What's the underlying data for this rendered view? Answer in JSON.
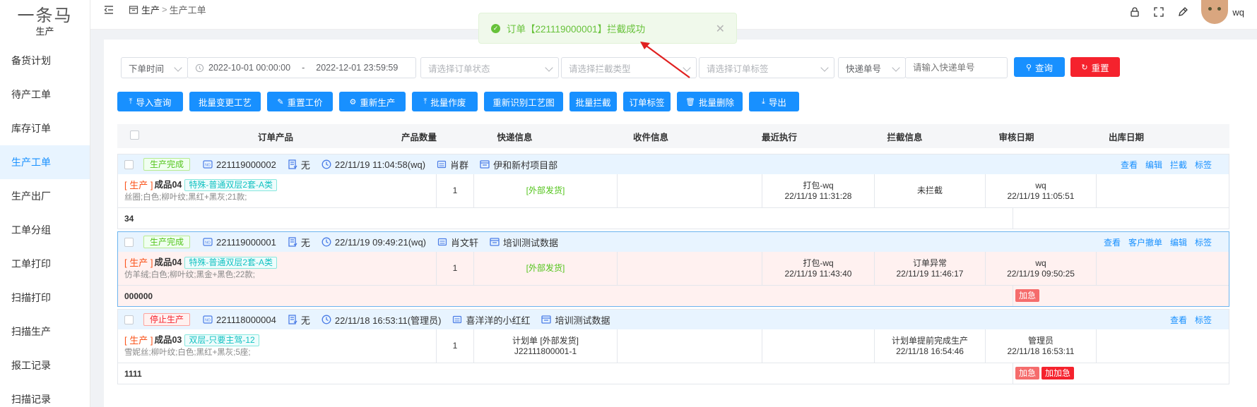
{
  "sidebar": {
    "logo": "一条马",
    "section": "生产",
    "items": [
      {
        "label": "备货计划"
      },
      {
        "label": "待产工单"
      },
      {
        "label": "库存订单"
      },
      {
        "label": "生产工单",
        "active": true
      },
      {
        "label": "生产出厂"
      },
      {
        "label": "工单分组"
      },
      {
        "label": "工单打印"
      },
      {
        "label": "扫描打印"
      },
      {
        "label": "扫描生产"
      },
      {
        "label": "报工记录"
      },
      {
        "label": "扫描记录"
      }
    ]
  },
  "header": {
    "breadcrumb": {
      "root": "生产",
      "separator": ">",
      "current": "生产工单"
    },
    "username": "wq",
    "icons": [
      "collapse-icon",
      "lock-icon",
      "fullscreen-icon",
      "brush-icon"
    ]
  },
  "toast": {
    "message": "订单【221119000001】拦截成功",
    "type": "success"
  },
  "filters": {
    "time_type": "下单时间",
    "date_start": "2022-10-01 00:00:00",
    "date_sep": "-",
    "date_end": "2022-12-01 23:59:59",
    "order_status_placeholder": "请选择订单状态",
    "intercept_type_placeholder": "请选择拦截类型",
    "order_tag_placeholder": "请选择订单标签",
    "express_type": "快递单号",
    "express_placeholder": "请输入快递单号",
    "search_label": "查询",
    "reset_label": "重置"
  },
  "actions": [
    {
      "label": "导入查询",
      "icon": "upload-icon"
    },
    {
      "label": "批量变更工艺",
      "icon": ""
    },
    {
      "label": "重置工价",
      "icon": "edit-icon"
    },
    {
      "label": "重新生产",
      "icon": "gear-icon"
    },
    {
      "label": "批量作废",
      "icon": "upload-icon"
    },
    {
      "label": "重新识别工艺图",
      "icon": ""
    },
    {
      "label": "批量拦截",
      "icon": ""
    },
    {
      "label": "订单标签",
      "icon": ""
    },
    {
      "label": "批量删除",
      "icon": "trash-icon"
    },
    {
      "label": "导出",
      "icon": "download-icon"
    }
  ],
  "table": {
    "columns": [
      "订单产品",
      "产品数量",
      "快递信息",
      "收件信息",
      "最近执行",
      "拦截信息",
      "审核日期",
      "出库日期"
    ]
  },
  "orders": [
    {
      "status": "生产完成",
      "status_color": "green",
      "order_no": "221119000002",
      "invoice": "无",
      "time": "22/11/19 11:04:58(wq)",
      "customer": "肖群",
      "project": "伊和新村项目部",
      "ops": [
        "查看",
        "编辑",
        "拦截",
        "标签"
      ],
      "product_type": "[ 生产 ]",
      "product_name": "成品04",
      "product_tag": "特殊-普通双层2套-A类",
      "product_desc": "丝圈;白色;柳叶纹;黑红+黑灰;21款;",
      "quantity": "1",
      "express": "[外部发货]",
      "express_sub": "",
      "recent_exec": "打包-wq",
      "recent_time": "22/11/19 11:31:28",
      "intercept": "未拦截",
      "intercept_time": "",
      "reviewer": "wq",
      "review_time": "22/11/19 11:05:51",
      "remark": "34",
      "badges": []
    },
    {
      "status": "生产完成",
      "status_color": "green",
      "order_no": "221119000001",
      "invoice": "无",
      "time": "22/11/19 09:49:21(wq)",
      "customer": "肖文轩",
      "project": "培训测试数据",
      "ops": [
        "查看",
        "客户撤单",
        "编辑",
        "标签"
      ],
      "product_type": "[ 生产 ]",
      "product_name": "成品04",
      "product_tag": "特殊-普通双层2套-A类",
      "product_desc": "仿羊绒;白色;柳叶纹;黑金+黑色;22款;",
      "quantity": "1",
      "express": "[外部发货]",
      "express_sub": "",
      "recent_exec": "打包-wq",
      "recent_time": "22/11/19 11:43:40",
      "intercept": "订单异常",
      "intercept_time": "22/11/19 11:46:17",
      "reviewer": "wq",
      "review_time": "22/11/19 09:50:25",
      "remark": "000000",
      "badges": [
        {
          "label": "加急",
          "color": "#f56c6c"
        }
      ]
    },
    {
      "status": "停止生产",
      "status_color": "red",
      "order_no": "221118000004",
      "invoice": "无",
      "time": "22/11/18 16:53:11(管理员)",
      "customer": "喜洋洋的小红红",
      "project": "培训测试数据",
      "ops": [
        "查看",
        "标签"
      ],
      "product_type": "[ 生产 ]",
      "product_name": "成品03",
      "product_tag": "双层-只要主驾-12",
      "product_desc": "雪妮丝;柳叶纹;白色;黑红+黑灰;5座;",
      "quantity": "1",
      "express": "计划单 [外部发货]",
      "express_sub": "J22111800001-1",
      "recent_exec": "",
      "recent_time": "",
      "intercept": "计划单提前完成生产",
      "intercept_time": "22/11/18 16:54:46",
      "reviewer": "管理员",
      "review_time": "22/11/18 16:53:11",
      "remark": "1111",
      "badges": [
        {
          "label": "加急",
          "color": "#f56c6c"
        },
        {
          "label": "加加急",
          "color": "#f5222d"
        }
      ]
    }
  ]
}
